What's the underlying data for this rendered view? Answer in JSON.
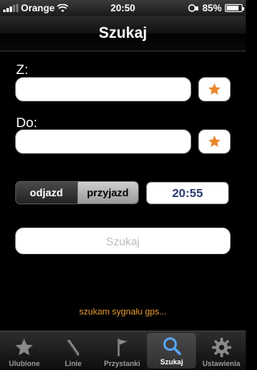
{
  "status": {
    "carrier": "Orange",
    "time": "20:50",
    "battery_percent": "85%",
    "battery_level": 0.85
  },
  "nav": {
    "title": "Szukaj"
  },
  "form": {
    "from_label": "Z:",
    "from_value": "",
    "to_label": "Do:",
    "to_value": "",
    "segment": {
      "options": [
        "odjazd",
        "przyjazd"
      ],
      "selected": "odjazd"
    },
    "time": "20:55",
    "search_label": "Szukaj"
  },
  "gps_status": "szukam sygnału gps...",
  "tabs": [
    {
      "label": "Ulubione",
      "icon": "star-icon"
    },
    {
      "label": "Linie",
      "icon": "pen-icon"
    },
    {
      "label": "Przystanki",
      "icon": "flag-icon"
    },
    {
      "label": "Szukaj",
      "icon": "magnifier-icon",
      "active": true
    },
    {
      "label": "Ustawienia",
      "icon": "gear-icon"
    }
  ],
  "colors": {
    "accent_star": "#e8862a",
    "gps_text": "#e59a2f",
    "time_text": "#2a3b6e"
  }
}
